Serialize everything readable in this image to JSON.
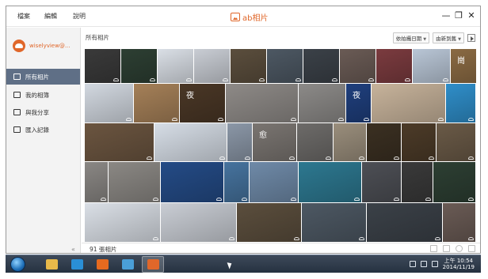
{
  "menu": {
    "file": "檔案",
    "edit": "編輯",
    "help": "說明"
  },
  "app": {
    "title": "ab相片",
    "accent": "#e0672a"
  },
  "window_controls": {
    "minimize": "—",
    "restore": "❐",
    "close": "✕"
  },
  "sidebar": {
    "account_name": "wiselyview@...",
    "items": [
      {
        "label": "所有相片",
        "icon": "photo-icon",
        "active": true
      },
      {
        "label": "我的相簿",
        "icon": "album-icon",
        "active": false
      },
      {
        "label": "與我分享",
        "icon": "share-icon",
        "active": false
      },
      {
        "label": "匯入記錄",
        "icon": "history-icon",
        "active": false
      }
    ],
    "collapse": "«"
  },
  "content": {
    "title": "所有相片",
    "sort_by": "依拍攝日期",
    "sort_order": "由新到舊"
  },
  "thumbnails": [
    {
      "color": "#3a3a3a",
      "overlay": ""
    },
    {
      "color": "#2d3f33",
      "overlay": ""
    },
    {
      "color": "#dadfe6",
      "overlay": ""
    },
    {
      "color": "#c9cdd4",
      "overlay": ""
    },
    {
      "color": "#5b4e3d",
      "overlay": ""
    },
    {
      "color": "#4d5863",
      "overlay": ""
    },
    {
      "color": "#3b4148",
      "overlay": ""
    },
    {
      "color": "#6a5b55",
      "overlay": ""
    },
    {
      "color": "#7b3b3f",
      "overlay": ""
    },
    {
      "color": "#b9c6d6",
      "overlay": ""
    },
    {
      "color": "#8a6a43",
      "overlay": "崗"
    },
    {
      "color": "#d2d8e0",
      "overlay": ""
    },
    {
      "color": "#a58058",
      "overlay": ""
    },
    {
      "color": "#4a3726",
      "overlay": "夜"
    },
    {
      "color": "#8e8a87",
      "overlay": ""
    },
    {
      "color": "#8c8a88",
      "overlay": ""
    },
    {
      "color": "#1f3f7d",
      "overlay": "夜"
    },
    {
      "color": "#c7b39b",
      "overlay": ""
    },
    {
      "color": "#2f8ec9",
      "overlay": ""
    },
    {
      "color": "#6b5540",
      "overlay": ""
    },
    {
      "color": "#d6dde6",
      "overlay": ""
    },
    {
      "color": "#8b97a7",
      "overlay": ""
    },
    {
      "color": "#7a7571",
      "overlay": "愈"
    },
    {
      "color": "#6d6b69",
      "overlay": ""
    },
    {
      "color": "#9a8e7c",
      "overlay": ""
    },
    {
      "color": "#3b3022",
      "overlay": ""
    },
    {
      "color": "#4c3b28",
      "overlay": ""
    },
    {
      "color": "#6a5a47",
      "overlay": ""
    },
    {
      "color": "#7e7b77",
      "overlay": ""
    },
    {
      "color": "#8a8784",
      "overlay": ""
    },
    {
      "color": "#8b8884",
      "overlay": ""
    },
    {
      "color": "#244b86",
      "overlay": ""
    },
    {
      "color": "#46739e",
      "overlay": ""
    },
    {
      "color": "#6f8aa8",
      "overlay": ""
    },
    {
      "color": "#2d7890",
      "overlay": ""
    },
    {
      "color": "#4d4f55",
      "overlay": ""
    }
  ],
  "status": {
    "photo_count": "91 張相片"
  },
  "taskbar": {
    "apps": [
      {
        "name": "explorer",
        "color": "#e8b94a",
        "active": false
      },
      {
        "name": "ie",
        "color": "#2a8fd6",
        "active": false
      },
      {
        "name": "firefox",
        "color": "#e66a1f",
        "active": false
      },
      {
        "name": "chat",
        "color": "#4a9fd8",
        "active": false
      },
      {
        "name": "ab-photos",
        "color": "#e0672a",
        "active": true
      }
    ],
    "time": "上午 10:54",
    "date": "2014/11/19"
  }
}
